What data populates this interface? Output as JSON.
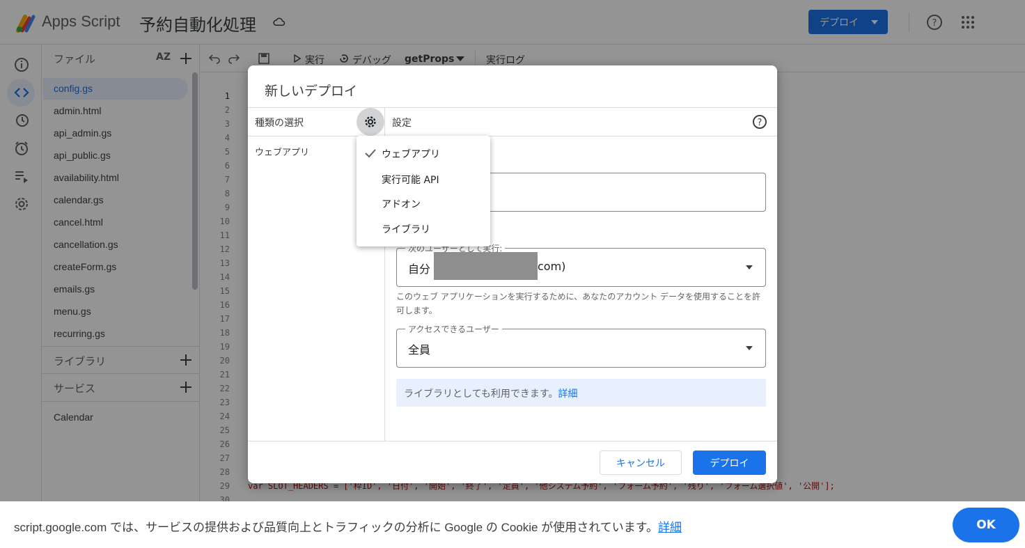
{
  "header": {
    "app_name": "Apps Script",
    "project_title": "予約自動化処理",
    "deploy_button": "デプロイ"
  },
  "files_panel": {
    "title": "ファイル",
    "sort_label": "AZ",
    "files": [
      "config.gs",
      "admin.html",
      "api_admin.gs",
      "api_public.gs",
      "availability.html",
      "calendar.gs",
      "cancel.html",
      "cancellation.gs",
      "createForm.gs",
      "emails.gs",
      "menu.gs",
      "recurring.gs"
    ],
    "libraries_label": "ライブラリ",
    "services_label": "サービス",
    "services": [
      "Calendar"
    ]
  },
  "toolbar": {
    "run": "実行",
    "debug": "デバッグ",
    "function": "getProps",
    "exec_log": "実行ログ"
  },
  "editor": {
    "line_numbers": [
      "1",
      "2",
      "3",
      "4",
      "5",
      "6",
      "7",
      "8",
      "9",
      "10",
      "11",
      "12",
      "13",
      "14",
      "15",
      "16",
      "17",
      "18",
      "19",
      "20",
      "21",
      "22",
      "23",
      "24",
      "25",
      "26",
      "27",
      "28",
      "29",
      "30"
    ],
    "visible_code": "var SLOT_HEADERS = ['枠ID', '日付', '開始', '終了', '定員', '他システム予約', 'フォーム予約', '残り', 'フォーム選択値', '公開'];"
  },
  "dialog": {
    "title": "新しいデプロイ",
    "type_select_label": "種類の選択",
    "settings_label": "設定",
    "selected_type": "ウェブアプリ",
    "execute_as_legend": "次のユーザーとして実行:",
    "execute_as_value_prefix": "自分",
    "execute_as_value_suffix": "com)",
    "help_text": "このウェブ アプリケーションを実行するために、あなたのアカウント データを使用することを許可します。",
    "access_legend": "アクセスできるユーザー",
    "access_value": "全員",
    "info_text": "ライブラリとしても利用できます。",
    "info_link": "詳細",
    "cancel_button": "キャンセル",
    "deploy_button": "デプロイ"
  },
  "type_menu": {
    "items": [
      "ウェブアプリ",
      "実行可能 API",
      "アドオン",
      "ライブラリ"
    ],
    "checked_index": 0
  },
  "cookie_bar": {
    "text": "script.google.com では、サービスの提供および品質向上とトラフィックの分析に Google の Cookie が使用されています。",
    "link": "詳細",
    "ok_button": "OK"
  },
  "colors": {
    "accent": "#1a73e8",
    "selected_bg": "#e8f0fe"
  }
}
